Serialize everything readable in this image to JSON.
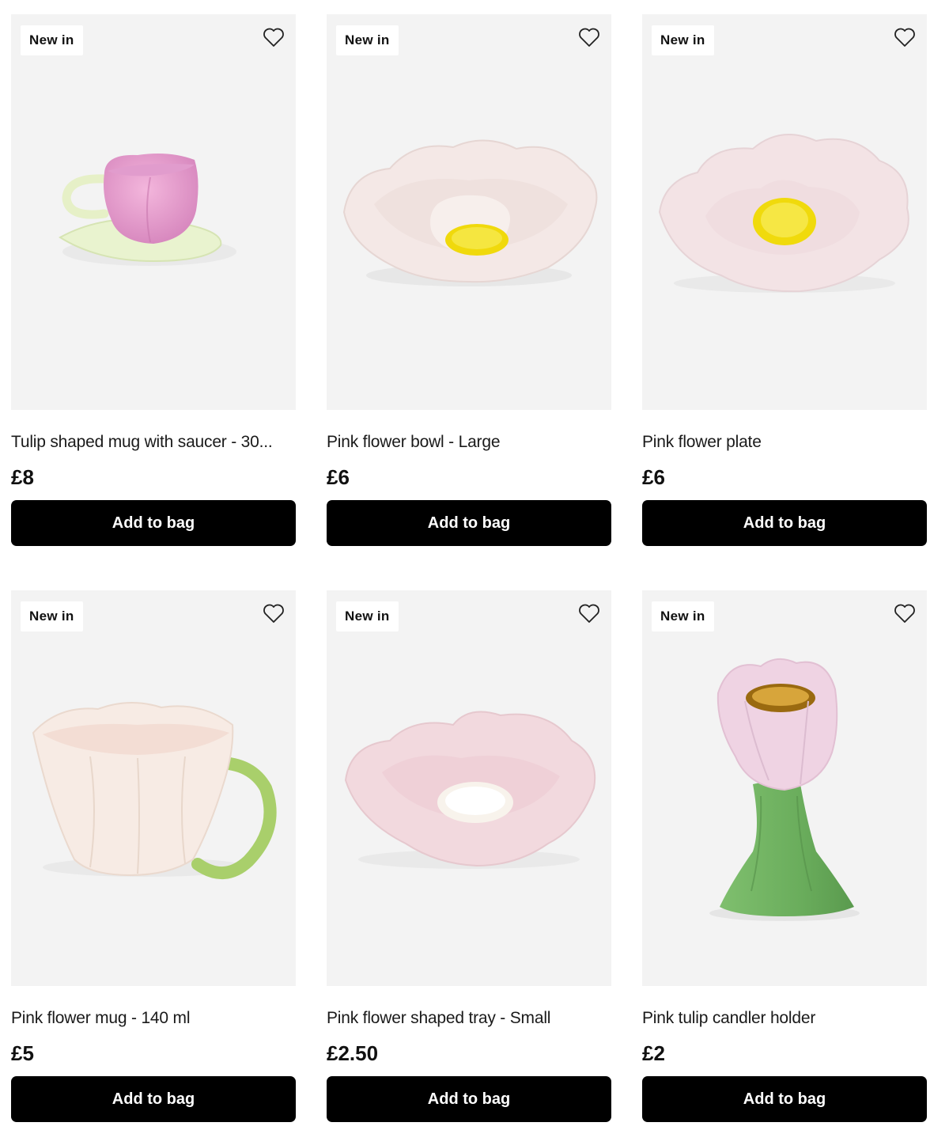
{
  "products": [
    {
      "badge": "New in",
      "title": "Tulip shaped mug with saucer - 30...",
      "price": "£8",
      "button": "Add to bag",
      "wishlist_icon": "heart-outline-icon",
      "image": "tulip-mug-saucer"
    },
    {
      "badge": "New in",
      "title": "Pink flower bowl - Large",
      "price": "£6",
      "button": "Add to bag",
      "wishlist_icon": "heart-outline-icon",
      "image": "pink-flower-bowl"
    },
    {
      "badge": "New in",
      "title": "Pink flower plate",
      "price": "£6",
      "button": "Add to bag",
      "wishlist_icon": "heart-outline-icon",
      "image": "pink-flower-plate"
    },
    {
      "badge": "New in",
      "title": "Pink flower mug - 140 ml",
      "price": "£5",
      "button": "Add to bag",
      "wishlist_icon": "heart-outline-icon",
      "image": "pink-flower-mug"
    },
    {
      "badge": "New in",
      "title": "Pink flower shaped tray - Small",
      "price": "£2.50",
      "button": "Add to bag",
      "wishlist_icon": "heart-outline-icon",
      "image": "pink-flower-tray"
    },
    {
      "badge": "New in",
      "title": "Pink tulip candler holder",
      "price": "£2",
      "button": "Add to bag",
      "wishlist_icon": "heart-outline-icon",
      "image": "pink-tulip-candle-holder"
    }
  ],
  "colors": {
    "button_bg": "#000000",
    "button_text": "#ffffff",
    "image_bg": "#f3f3f3",
    "badge_bg": "#ffffff"
  }
}
